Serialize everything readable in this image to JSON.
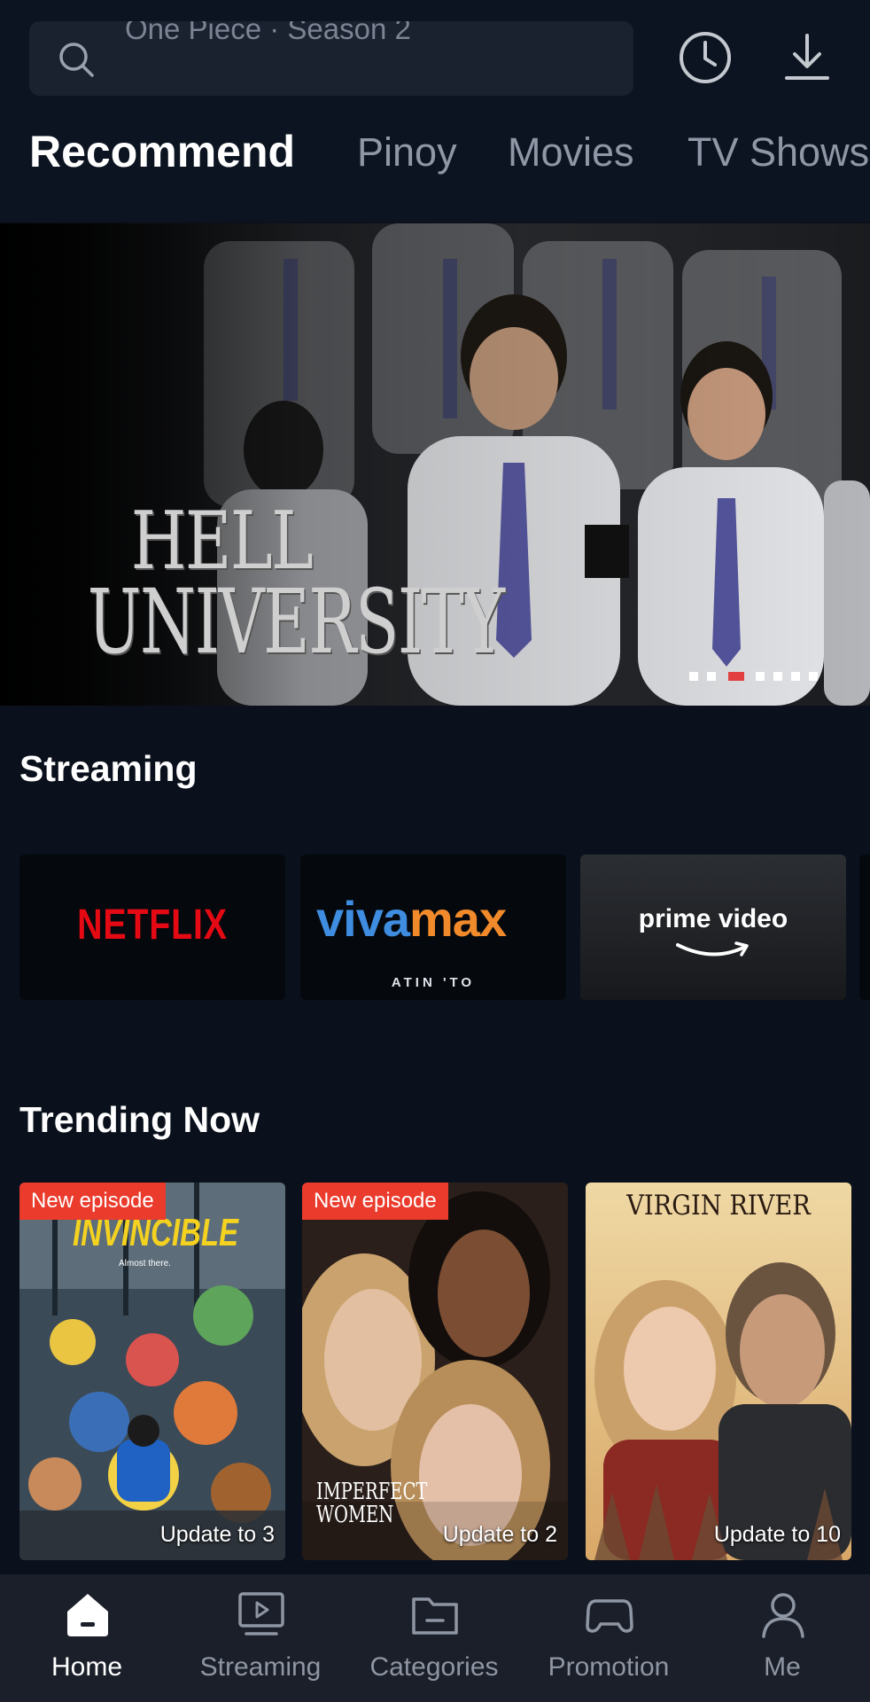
{
  "search": {
    "placeholder": "One Piece · Season 2",
    "icon": "search-icon"
  },
  "header_icons": [
    "history-clock-icon",
    "download-icon"
  ],
  "tabs": [
    {
      "label": "Recommend",
      "active": true
    },
    {
      "label": "Pinoy",
      "active": false
    },
    {
      "label": "Movies",
      "active": false
    },
    {
      "label": "TV Shows",
      "active": false
    }
  ],
  "banner": {
    "title_line1": "HELL",
    "title_line2": "UNIVERSITY",
    "slide_count": 7,
    "active_slide": 3
  },
  "streaming": {
    "title": "Streaming",
    "providers": [
      {
        "name": "NETFLIX",
        "color": "#e50914"
      },
      {
        "name_part1": "viva",
        "name_part2": "max",
        "tagline": "ATIN 'TO"
      },
      {
        "name": "prime video"
      }
    ]
  },
  "trending": {
    "title": "Trending Now",
    "items": [
      {
        "poster_title": "INVINCIBLE",
        "poster_tagline": "Almost there.",
        "badge": "New episode",
        "update": "Update to 3"
      },
      {
        "poster_title": "IMPERFECT WOMEN",
        "badge": "New episode",
        "update": "Update to 2"
      },
      {
        "poster_title": "VIRGIN RIVER",
        "badge": "",
        "update": "Update to 10"
      }
    ]
  },
  "bottom_nav": [
    {
      "label": "Home",
      "icon": "home-icon",
      "active": true
    },
    {
      "label": "Streaming",
      "icon": "play-screen-icon",
      "active": false
    },
    {
      "label": "Categories",
      "icon": "folder-icon",
      "active": false
    },
    {
      "label": "Promotion",
      "icon": "gamepad-icon",
      "active": false
    },
    {
      "label": "Me",
      "icon": "user-icon",
      "active": false
    }
  ],
  "colors": {
    "background": "#0b111c",
    "accent_red": "#ea3b2c",
    "tab_inactive": "#8f97a6",
    "nav_bg": "#1a1f29"
  }
}
